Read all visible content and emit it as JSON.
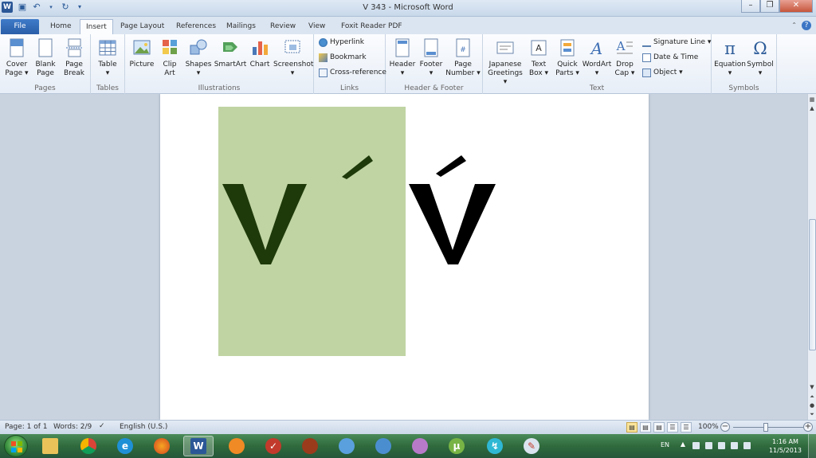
{
  "window": {
    "title": "V 343  -  Microsoft Word",
    "word_logo": "W",
    "min": "–",
    "restore": "❐",
    "close": "✕"
  },
  "tabs": {
    "file": "File",
    "home": "Home",
    "insert": "Insert",
    "page_layout": "Page Layout",
    "references": "References",
    "mailings": "Mailings",
    "review": "Review",
    "view": "View",
    "foxit": "Foxit Reader PDF",
    "help": "?"
  },
  "ribbon": {
    "pages": {
      "label": "Pages",
      "cover_page": [
        "Cover",
        "Page ▾"
      ],
      "blank_page": [
        "Blank",
        "Page"
      ],
      "page_break": [
        "Page",
        "Break"
      ]
    },
    "tables": {
      "label": "Tables",
      "table": [
        "Table",
        "▾"
      ]
    },
    "illustrations": {
      "label": "Illustrations",
      "picture": "Picture",
      "clip_art": [
        "Clip",
        "Art"
      ],
      "shapes": [
        "Shapes",
        "▾"
      ],
      "smartart": "SmartArt",
      "chart": "Chart",
      "screenshot": [
        "Screenshot",
        "▾"
      ]
    },
    "links": {
      "label": "Links",
      "hyperlink": "Hyperlink",
      "bookmark": "Bookmark",
      "cross_reference": "Cross-reference"
    },
    "header_footer": {
      "label": "Header & Footer",
      "header": [
        "Header",
        "▾"
      ],
      "footer": [
        "Footer",
        "▾"
      ],
      "page_number": [
        "Page",
        "Number ▾"
      ]
    },
    "text": {
      "label": "Text",
      "japanese_greetings": [
        "Japanese",
        "Greetings ▾"
      ],
      "text_box": [
        "Text",
        "Box ▾"
      ],
      "quick_parts": [
        "Quick",
        "Parts ▾"
      ],
      "wordart": [
        "WordArt",
        "▾"
      ],
      "drop_cap": [
        "Drop",
        "Cap ▾"
      ],
      "signature_line": "Signature Line ▾",
      "date_time": "Date & Time",
      "object": "Object ▾"
    },
    "symbols": {
      "label": "Symbols",
      "equation": [
        "Equation",
        "▾"
      ],
      "symbol": [
        "Symbol",
        "▾"
      ]
    }
  },
  "document": {
    "glyph_v": "V",
    "glyph_accent": "´",
    "glyph_v_accented": "V",
    "box_color": "#c0d4a3",
    "dark_glyph_color": "#1f3a0a"
  },
  "status": {
    "page": "Page: 1 of 1",
    "words": "Words: 2/9",
    "language": "English (U.S.)",
    "zoom": "100%",
    "zoom_minus": "−",
    "zoom_plus": "+"
  },
  "taskbar": {
    "lang": "EN",
    "time": "1:16 AM",
    "date": "11/5/2013"
  }
}
